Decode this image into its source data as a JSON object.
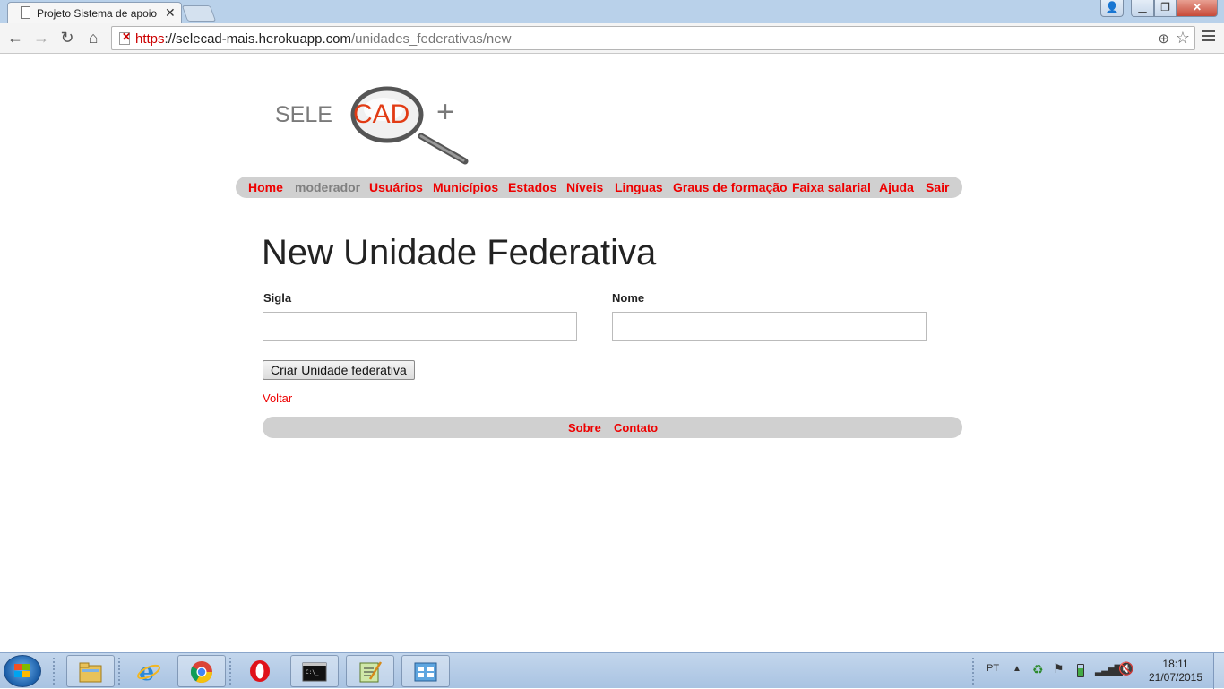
{
  "browser": {
    "tab_title": "Projeto Sistema de apoio",
    "url_protocol": "https",
    "url_separator": "://",
    "url_host": "selecad-mais.herokuapp.com",
    "url_path": "/unidades_federativas/new"
  },
  "site": {
    "logo_text_left": "SELE",
    "logo_text_center": "CAD",
    "logo_text_right": "+",
    "nav": [
      "Home",
      "moderador",
      "Usuários",
      "Municípios",
      "Estados",
      "Níveis",
      "Linguas",
      "Graus de formação",
      "Faixa salarial",
      "Ajuda",
      "Sair"
    ],
    "nav_muted_item": "moderador"
  },
  "form": {
    "title": "New Unidade Federativa",
    "sigla_label": "Sigla",
    "sigla_value": "",
    "nome_label": "Nome",
    "nome_value": "",
    "submit_label": "Criar Unidade federativa",
    "back_link": "Voltar"
  },
  "footer": {
    "links": [
      "Sobre",
      "Contato"
    ]
  },
  "taskbar": {
    "language": "PT",
    "time": "18:11",
    "date": "21/07/2015"
  },
  "colors": {
    "link_red": "#ee0000",
    "nav_bg": "#d0d0d0",
    "muted": "#808080"
  }
}
